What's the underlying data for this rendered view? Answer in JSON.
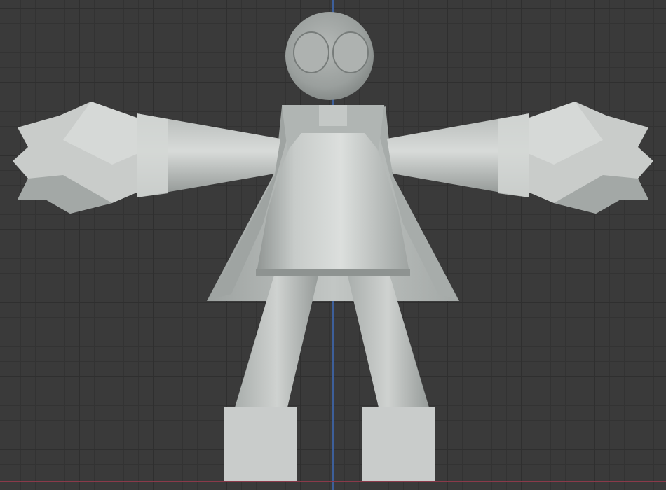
{
  "viewport": {
    "mode": "front-orthographic",
    "grid": true,
    "axes": {
      "vertical": "z-axis",
      "horizontal": "x-axis"
    },
    "colors": {
      "background": "#3a3a3a",
      "grid_major": "#2f2f2f",
      "grid_minor": "#333333",
      "axis_vertical": "#3d5f9a",
      "axis_horizontal": "#8a3a4a",
      "mesh_base": "#bfc3c1",
      "mesh_shadow": "#8e9391",
      "mesh_highlight": "#dfe2e0"
    }
  },
  "mesh": {
    "object": "humanoid-figure",
    "parts": [
      "head",
      "eye-left",
      "eye-right",
      "neck",
      "collar",
      "cape",
      "torso",
      "arm-left",
      "arm-right",
      "hand-left",
      "hand-right",
      "leg-left",
      "leg-right",
      "foot-left",
      "foot-right"
    ]
  }
}
